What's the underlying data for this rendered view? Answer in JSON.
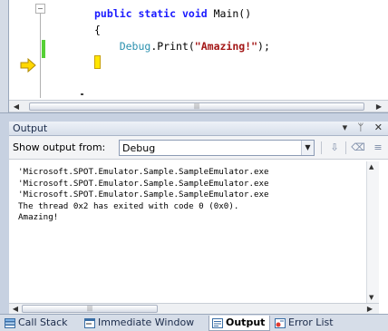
{
  "editor": {
    "code_lines": {
      "signature": {
        "kw1": "public",
        "kw2": "static",
        "kw3": "void",
        "name": "Main()"
      },
      "open_brace": "{",
      "call": {
        "type": "Debug",
        "method": ".Print(",
        "arg": "\"Amazing!\"",
        "end": ");"
      }
    }
  },
  "output": {
    "title": "Output",
    "title_icons": [
      "pin-dropdown-icon",
      "autohide-pin-icon",
      "close-icon"
    ],
    "title_glyphs": {
      "dropdown": "▾",
      "pin": "ᛘ",
      "close": "✕"
    },
    "show_from_label": "Show output from:",
    "source_value": "Debug",
    "lines": [
      "'Microsoft.SPOT.Emulator.Sample.SampleEmulator.exe",
      "'Microsoft.SPOT.Emulator.Sample.SampleEmulator.exe",
      "'Microsoft.SPOT.Emulator.Sample.SampleEmulator.exe",
      "The thread 0x2 has exited with code 0 (0x0).",
      "Amazing!"
    ]
  },
  "tabs": [
    {
      "label": "Call Stack",
      "icon": "call-stack-icon",
      "active": false
    },
    {
      "label": "Immediate Window",
      "icon": "immediate-window-icon",
      "active": false
    },
    {
      "label": "Output",
      "icon": "output-icon",
      "active": true
    },
    {
      "label": "Error List",
      "icon": "error-list-icon",
      "active": false
    }
  ],
  "colors": {
    "keyword": "#1a1aff",
    "string": "#a31515",
    "type": "#2b91af",
    "change_bar": "#56d036",
    "execution_arrow": "#ffd800",
    "tool_frame": "#c7d1e1"
  }
}
